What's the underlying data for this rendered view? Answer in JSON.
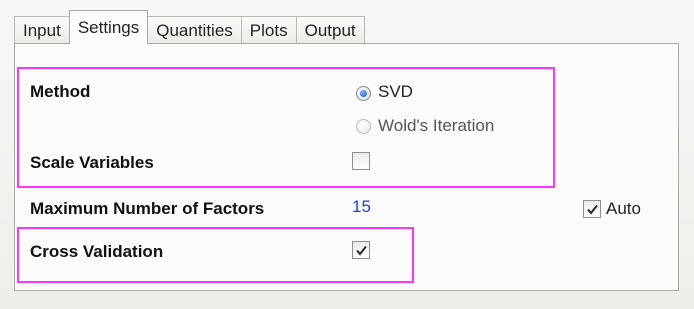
{
  "tabs": [
    {
      "label": "Input"
    },
    {
      "label": "Settings"
    },
    {
      "label": "Quantities"
    },
    {
      "label": "Plots"
    },
    {
      "label": "Output"
    }
  ],
  "active_tab": "Settings",
  "method": {
    "label": "Method",
    "options": [
      {
        "label": "SVD",
        "selected": true
      },
      {
        "label": "Wold's Iteration",
        "selected": false,
        "enabled": false
      }
    ]
  },
  "scale_variables": {
    "label": "Scale Variables",
    "checked": false
  },
  "max_factors": {
    "label": "Maximum Number of Factors",
    "value": "15",
    "auto_label": "Auto",
    "auto_checked": true
  },
  "cross_validation": {
    "label": "Cross Validation",
    "checked": true
  },
  "colors": {
    "highlight": "#ff33ff",
    "value_text": "#1d3fd6"
  }
}
